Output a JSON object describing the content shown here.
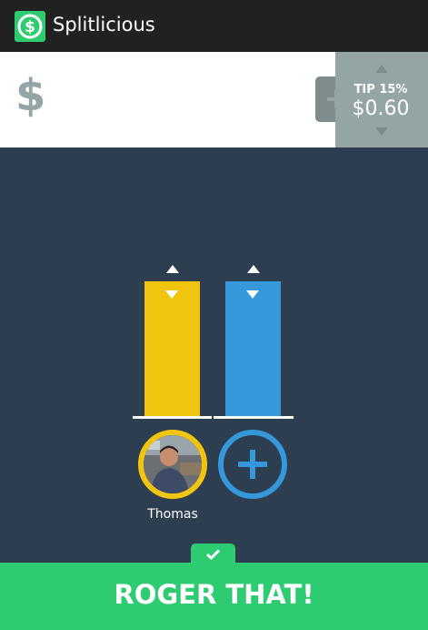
{
  "app": {
    "title": "Splitlicious"
  },
  "bill": {
    "currency_symbol": "$"
  },
  "tip": {
    "label": "TIP 15%",
    "amount": "$0.60"
  },
  "people": [
    {
      "name": "Thomas",
      "color": "#f1c40f"
    }
  ],
  "add_person": {
    "color": "#3498db"
  },
  "confirm": {
    "label": "ROGER THAT!"
  },
  "colors": {
    "accent_green": "#2ecc71",
    "panel_gray": "#95a5a6",
    "background": "#2c3e50"
  }
}
